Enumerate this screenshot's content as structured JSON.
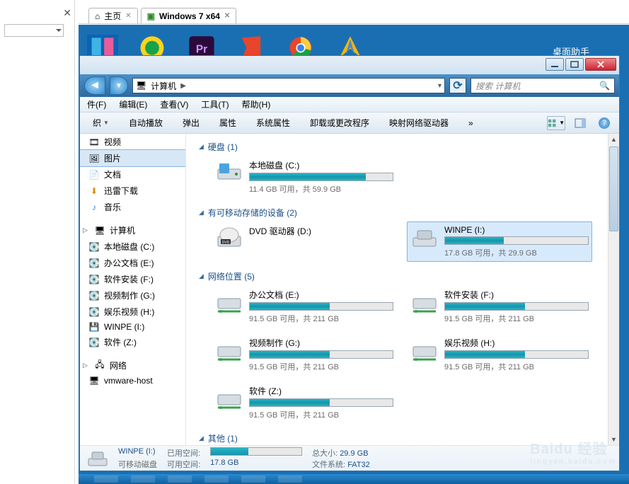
{
  "outer_tabs": [
    {
      "label": "主页",
      "icon": "home-icon"
    },
    {
      "label": "Windows 7 x64",
      "icon": "vm-icon"
    }
  ],
  "desktop": {
    "assistant": "桌面助手"
  },
  "window": {
    "buttons": {
      "min": "min",
      "max": "max",
      "close": "close"
    },
    "address": {
      "root": "计算机",
      "arrow": "▶"
    },
    "refresh": "⟳",
    "search_placeholder": "搜索 计算机"
  },
  "menu": [
    "件(F)",
    "编辑(E)",
    "查看(V)",
    "工具(T)",
    "帮助(H)"
  ],
  "commands": {
    "organize": "织",
    "items": [
      "自动播放",
      "弹出",
      "属性",
      "系统属性",
      "卸载或更改程序",
      "映射网络驱动器"
    ],
    "more": "»"
  },
  "nav": {
    "libs": [
      {
        "label": "视频",
        "icon": "video-icon"
      },
      {
        "label": "图片",
        "icon": "picture-icon",
        "selected": true
      },
      {
        "label": "文档",
        "icon": "doc-icon"
      },
      {
        "label": "迅雷下载",
        "icon": "download-icon"
      },
      {
        "label": "音乐",
        "icon": "music-icon"
      }
    ],
    "computer_label": "计算机",
    "drives": [
      {
        "label": "本地磁盘 (C:)"
      },
      {
        "label": "办公文档 (E:)"
      },
      {
        "label": "软件安装 (F:)"
      },
      {
        "label": "视频制作 (G:)"
      },
      {
        "label": "娱乐视频 (H:)"
      },
      {
        "label": "WINPE (I:)"
      },
      {
        "label": "软件 (Z:)"
      }
    ],
    "network_label": "网络",
    "network_items": [
      {
        "label": "vmware-host"
      }
    ]
  },
  "sections": {
    "hdd": {
      "title": "硬盘 (1)"
    },
    "removable": {
      "title": "有可移动存储的设备 (2)"
    },
    "netloc": {
      "title": "网络位置 (5)"
    },
    "other": {
      "title": "其他 (1)"
    }
  },
  "drives": {
    "c": {
      "title": "本地磁盘 (C:)",
      "sub": "11.4 GB 可用，共 59.9 GB",
      "pct": 81
    },
    "dvd": {
      "title": "DVD 驱动器 (D:)"
    },
    "i": {
      "title": "WINPE (I:)",
      "sub": "17.8 GB 可用，共 29.9 GB",
      "pct": 41
    },
    "e": {
      "title": "办公文档 (E:)",
      "sub": "91.5 GB 可用，共 211 GB",
      "pct": 56
    },
    "f": {
      "title": "软件安装 (F:)",
      "sub": "91.5 GB 可用，共 211 GB",
      "pct": 56
    },
    "g": {
      "title": "视频制作 (G:)",
      "sub": "91.5 GB 可用，共 211 GB",
      "pct": 56
    },
    "h": {
      "title": "娱乐视频 (H:)",
      "sub": "91.5 GB 可用，共 211 GB",
      "pct": 56
    },
    "z": {
      "title": "软件 (Z:)",
      "sub": "91.5 GB 可用，共 211 GB",
      "pct": 56
    }
  },
  "details": {
    "name": "WINPE (I:)",
    "type": "可移动磁盘",
    "used_k": "已用空间:",
    "free_k": "可用空间:",
    "free_v": "17.8 GB",
    "total_k": "总大小:",
    "total_v": "29.9 GB",
    "fs_k": "文件系统:",
    "fs_v": "FAT32",
    "pct": 41
  },
  "watermark": {
    "brand": "Baidu 经验",
    "sub": "jingyan.baidu.com"
  }
}
